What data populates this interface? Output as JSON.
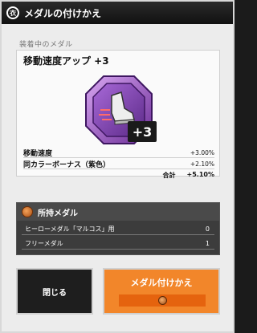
{
  "window": {
    "title": "メダルの付けかえ",
    "title_icon_glyph": "衣"
  },
  "equipped": {
    "section_label": "装着中のメダル",
    "medal_name": "移動速度アップ +3",
    "plus_badge": "+3",
    "medal_color": "#8a46b8",
    "stats": [
      {
        "label": "移動速度",
        "value": "+3.00%"
      },
      {
        "label": "同カラーボーナス（紫色）",
        "value": "+2.10%"
      }
    ],
    "total_label": "合計",
    "total_value": "+5.10%"
  },
  "owned": {
    "header": "所持メダル",
    "rows": [
      {
        "label": "ヒーローメダル「マルコス」用",
        "count": "0"
      },
      {
        "label": "フリーメダル",
        "count": "1"
      }
    ]
  },
  "buttons": {
    "close_label": "閉じる",
    "change_label": "メダル付けかえ"
  }
}
